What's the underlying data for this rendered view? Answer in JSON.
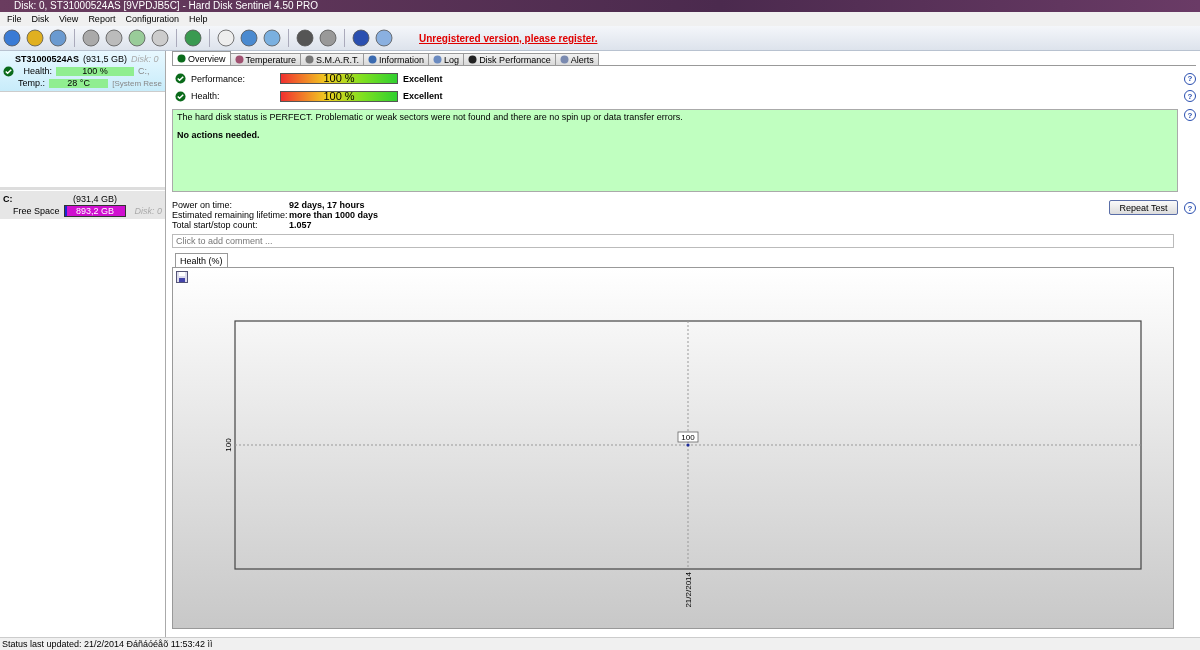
{
  "window": {
    "title": "Disk: 0, ST31000524AS [9VPDJB5C]  -  Hard Disk Sentinel 4.50 PRO"
  },
  "menu": [
    "File",
    "Disk",
    "View",
    "Report",
    "Configuration",
    "Help"
  ],
  "register_link": "Unregistered version, please register.",
  "disks": [
    {
      "name": "ST31000524AS",
      "size": "(931,5 GB)",
      "disk": "Disk: 0",
      "selected": true,
      "health_label": "Health:",
      "health_value": "100 %",
      "drive": "C:,",
      "temp_label": "Temp.:",
      "temp_value": "28 °C",
      "volume": "[System Rese"
    }
  ],
  "partitions": [
    {
      "drive": "C:",
      "size": "(931,4 GB)",
      "free_label": "Free Space",
      "free_value": "893,2 GB",
      "level": 0.96,
      "disk": "Disk: 0"
    }
  ],
  "tabs": [
    {
      "label": "Overview",
      "selected": true
    },
    {
      "label": "Temperature",
      "selected": false
    },
    {
      "label": "S.M.A.R.T.",
      "selected": false
    },
    {
      "label": "Information",
      "selected": false
    },
    {
      "label": "Log",
      "selected": false
    },
    {
      "label": "Disk Performance",
      "selected": false
    },
    {
      "label": "Alerts",
      "selected": false
    }
  ],
  "meters": [
    {
      "label": "Performance:",
      "value": "100 %",
      "level": 1,
      "rating": "Excellent"
    },
    {
      "label": "Health:",
      "value": "100 %",
      "level": 1,
      "rating": "Excellent"
    }
  ],
  "status_text": "The hard disk status is PERFECT. Problematic or weak sectors were not found and there are no spin up or data transfer errors.",
  "status_action": "No actions needed.",
  "info": [
    {
      "label": "Power on time:",
      "value": "92 days, 17 hours"
    },
    {
      "label": "Estimated remaining lifetime:",
      "value": "more than 1000 days"
    },
    {
      "label": "Total start/stop count:",
      "value": "1.057"
    }
  ],
  "repeat_button": "Repeat Test",
  "comment": {
    "placeholder": "Click to add comment ..."
  },
  "chart_tabs": [
    {
      "label": "Health (%)",
      "selected": true
    }
  ],
  "help_marks": [
    "?",
    "?",
    "?",
    "?"
  ],
  "health_chart": {
    "y_mark": "100",
    "x_mark": "21/2/2014",
    "point_label": "100"
  },
  "status_bar": "Status last updated: 21/2/2014 Ðáñáóéåõ 11:53:42 ìì"
}
